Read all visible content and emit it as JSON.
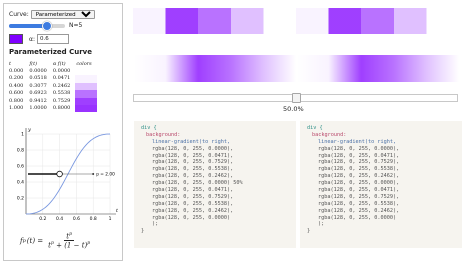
{
  "controls": {
    "curve_label": "Curve:",
    "curve_options": [
      "Parameterized"
    ],
    "curve_selected": "Parameterized",
    "n_label": "N=5",
    "n_value": 5,
    "color_hex": "#8000ff",
    "alpha_label": "α:",
    "alpha_value": "0.6"
  },
  "panel": {
    "title": "Parameterized Curve",
    "table": {
      "headers": [
        "t",
        "f(t)",
        "α f(t)",
        "colors"
      ],
      "rows": [
        {
          "t": "0.000",
          "f": "0.0000",
          "af": "0.0000"
        },
        {
          "t": "0.200",
          "f": "0.0518",
          "af": "0.0471"
        },
        {
          "t": "0.400",
          "f": "0.3077",
          "af": "0.2462"
        },
        {
          "t": "0.600",
          "f": "0.6923",
          "af": "0.5538"
        },
        {
          "t": "0.800",
          "f": "0.9412",
          "af": "0.7529"
        },
        {
          "t": "1.000",
          "f": "1.0000",
          "af": "0.8000"
        }
      ],
      "swatch_alphas": [
        0.0,
        0.0471,
        0.2462,
        0.5538,
        0.7529,
        0.8
      ]
    },
    "formula": {
      "lhs": "f",
      "sub": "p",
      "arg": "(t) =",
      "num": "t",
      "num_sup": "p",
      "den_a": "t",
      "den_b": " + (1 − t)"
    }
  },
  "chart": {
    "y_axis_label": "y",
    "x_axis_label": "t",
    "x_ticks": [
      "0.2",
      "0.4",
      "0.6",
      "0.8",
      "1"
    ],
    "y_ticks": [
      "0.2",
      "0.4",
      "0.6",
      "0.8",
      "1"
    ],
    "annotation": "p = 2.00",
    "p": 2.0
  },
  "gradient": {
    "color_rgb": "128, 0, 255",
    "stops_alpha": [
      0.0,
      0.0471,
      0.7529,
      0.5538,
      0.2462,
      0.0,
      0.0471,
      0.7529,
      0.5538,
      0.2462,
      0.0
    ]
  },
  "slider": {
    "value_pct": 50.0,
    "label": "50.0%"
  },
  "code_left": {
    "selector": "div {",
    "property": "background:",
    "fn": "linear-gradient(to right,",
    "lines": [
      "rgba(128, 0, 255, 0.0000),",
      "rgba(128, 0, 255, 0.0471),",
      "rgba(128, 0, 255, 0.7529),",
      "rgba(128, 0, 255, 0.5538),",
      "rgba(128, 0, 255, 0.2462),",
      "rgba(128, 0, 255, 0.0000) 50%",
      "rgba(128, 0, 255, 0.0471),",
      "rgba(128, 0, 255, 0.7529),",
      "rgba(128, 0, 255, 0.5538),",
      "rgba(128, 0, 255, 0.2462),",
      "rgba(128, 0, 255, 0.0000)",
      ");"
    ],
    "closing": "}"
  },
  "code_right": {
    "selector": "div {",
    "property": "background:",
    "fn": "linear-gradient(to right,",
    "lines": [
      "rgba(128, 0, 255, 0.0000),",
      "rgba(128, 0, 255, 0.0471),",
      "rgba(128, 0, 255, 0.7529),",
      "rgba(128, 0, 255, 0.5538),",
      "rgba(128, 0, 255, 0.2462),",
      "rgba(128, 0, 255, 0.0000),",
      "rgba(128, 0, 255, 0.0471),",
      "rgba(128, 0, 255, 0.7529),",
      "rgba(128, 0, 255, 0.5538),",
      "rgba(128, 0, 255, 0.2462),",
      "rgba(128, 0, 255, 0.0000)",
      ");"
    ],
    "closing": "}"
  }
}
